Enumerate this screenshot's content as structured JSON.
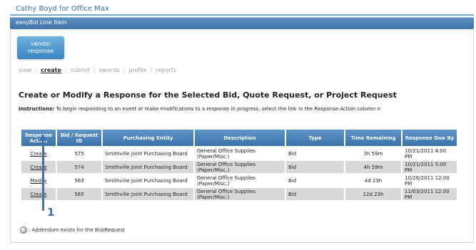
{
  "header": {
    "brand_text": "Cathy Boyd for Office Max",
    "app_title": "easyBid Line Item"
  },
  "vendor_button": {
    "line1": "vendor",
    "line2": "response"
  },
  "subnav": {
    "items": [
      "view",
      "create",
      "submit",
      "awards",
      "profile",
      "reports"
    ],
    "active": "create"
  },
  "page": {
    "heading": "Create or Modify a Response for the Selected Bid, Quote Request, or Project Request",
    "instructions_label": "Instructions:",
    "instructions_text": "To begin responding to an event or make modifications to a response in progress, select the link in the Response Action column n"
  },
  "table": {
    "headers": [
      "Response Action",
      "Bid / Request ID",
      "Purchasing Entity",
      "Description",
      "Type",
      "Time Remaining",
      "Response Due By"
    ],
    "rows": [
      {
        "action": "Create",
        "id": "575",
        "entity": "Smithville Joint Purchasing Board",
        "description": "General Office Supplies (Paper/Misc.)",
        "type": "Bid",
        "time_remaining": "3h 59m",
        "due": "10/21/2011 4:00 PM",
        "urgent": true
      },
      {
        "action": "Create",
        "id": "574",
        "entity": "Smithville Joint Purchasing Board",
        "description": "General Office Supplies (Paper/Misc.)",
        "type": "Bid",
        "time_remaining": "4h 59m",
        "due": "10/21/2011 5:00 PM",
        "urgent": true
      },
      {
        "action": "Modify",
        "id": "563",
        "entity": "Smithville Joint Purchasing Board",
        "description": "General Office Supplies (Paper/Misc.)",
        "type": "Bid",
        "time_remaining": "4d 23h",
        "due": "10/26/2011 12:00 PM",
        "urgent": false
      },
      {
        "action": "Create",
        "id": "565",
        "entity": "Smithville Joint Purchasing Board",
        "description": "General Office Supplies (Paper/Misc.)",
        "type": "Bid",
        "time_remaining": "12d 23h",
        "due": "11/03/2011 12:00 PM",
        "urgent": false
      }
    ]
  },
  "legend": {
    "icon": "addendum-icon",
    "text": ": Addendum exists for the Bid/Request"
  },
  "annotation": {
    "number": "1"
  },
  "colors": {
    "header_blue": "#3b72aa",
    "urgent_red": "#d12a2a",
    "link_blue": "#3b76b4"
  }
}
